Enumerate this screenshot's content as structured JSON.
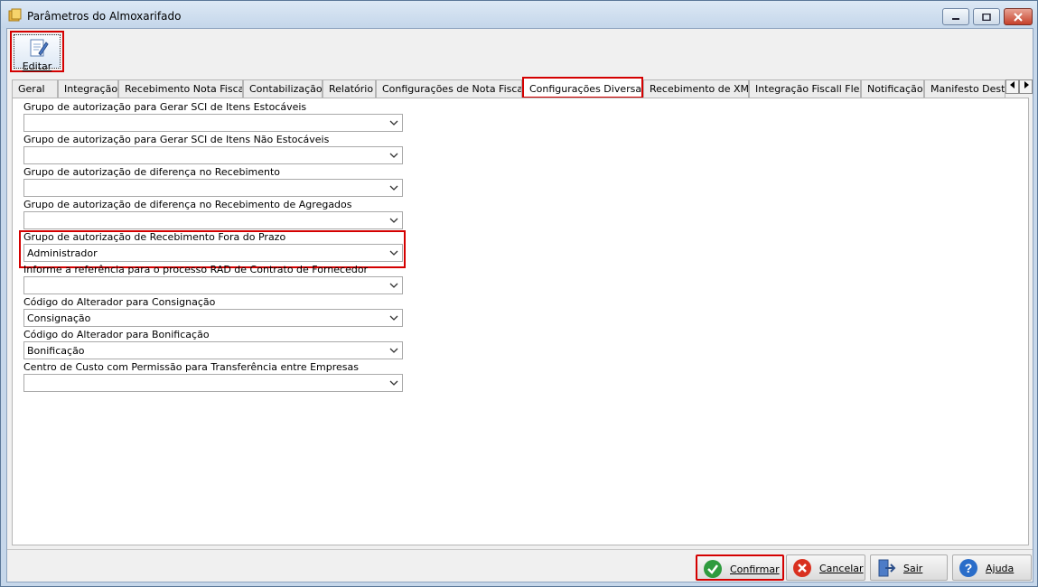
{
  "window": {
    "title": "Parâmetros do Almoxarifado"
  },
  "toolbar": {
    "edit_label": "Editar"
  },
  "tabs": [
    {
      "label": "Geral"
    },
    {
      "label": "Integração"
    },
    {
      "label": "Recebimento Nota Fiscal"
    },
    {
      "label": "Contabilização"
    },
    {
      "label": "Relatório"
    },
    {
      "label": "Configurações de Nota Fiscal"
    },
    {
      "label": "Configurações Diversas",
      "active": true
    },
    {
      "label": "Recebimento de XML"
    },
    {
      "label": "Integração Fiscall Flex"
    },
    {
      "label": "Notificação"
    },
    {
      "label": "Manifesto Dest"
    }
  ],
  "fields": [
    {
      "label": "Grupo de autorização para Gerar SCI de Itens Estocáveis",
      "value": ""
    },
    {
      "label": "Grupo de autorização para Gerar SCI de Itens Não Estocáveis",
      "value": ""
    },
    {
      "label": "Grupo de autorização de diferença no Recebimento",
      "value": ""
    },
    {
      "label": "Grupo de autorização de diferença no Recebimento de Agregados",
      "value": ""
    },
    {
      "label": "Grupo de autorização de Recebimento Fora do Prazo",
      "value": "Administrador"
    },
    {
      "label": "Informe a referência para o processo RAD de Contrato de Fornecedor",
      "value": ""
    },
    {
      "label": "Código do Alterador para Consignação",
      "value": "Consignação"
    },
    {
      "label": "Código do Alterador para Bonificação",
      "value": "Bonificação"
    },
    {
      "label": "Centro de Custo com Permissão para Transferência entre Empresas",
      "value": ""
    }
  ],
  "buttons": {
    "confirm": "Confirmar",
    "cancel": "Cancelar",
    "exit": "Sair",
    "help": "Ajuda"
  },
  "colors": {
    "highlight": "#d40000",
    "confirm_icon": "#2e9b3e",
    "cancel_icon": "#d9301f",
    "help_icon": "#2a6dc9"
  }
}
